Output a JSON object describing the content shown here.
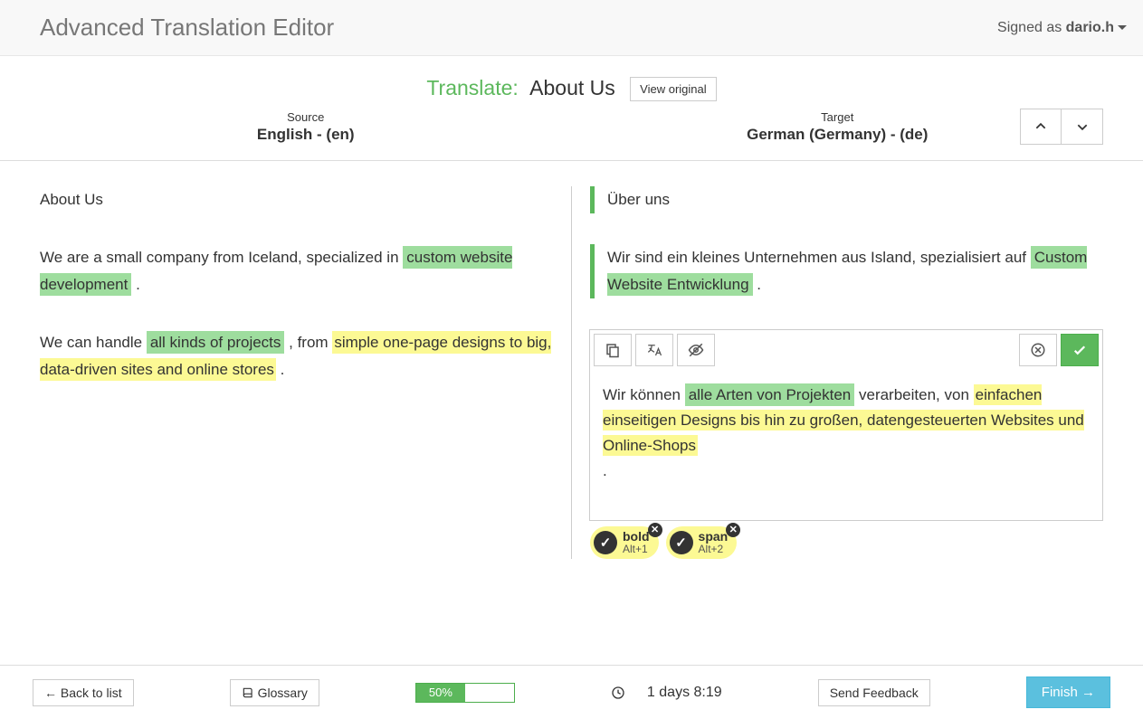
{
  "header": {
    "title": "Advanced Translation Editor",
    "signed_as_label": "Signed as ",
    "username": "dario.h"
  },
  "translate_header": {
    "label": "Translate:",
    "doc_title": "About Us",
    "view_original_label": "View original"
  },
  "langs": {
    "source_label": "Source",
    "source_name": "English - (en)",
    "target_label": "Target",
    "target_name": "German (Germany) - (de)"
  },
  "segments": {
    "src1": "About Us",
    "tgt1": "Über uns",
    "src2_pre": "We are a small company from Iceland, specialized in ",
    "src2_hl": "custom website development",
    "src2_post": " .",
    "tgt2_pre": "Wir sind ein kleines Unternehmen aus Island, spezialisiert auf ",
    "tgt2_hl": "Custom Website Entwicklung",
    "tgt2_post": " .",
    "src3_pre": "We can handle ",
    "src3_hl_green": "all kinds of projects",
    "src3_mid": " , from ",
    "src3_hl_yellow": "simple one-page designs to big, data-driven sites and online stores",
    "src3_post": " .",
    "tgt3_pre": "Wir können ",
    "tgt3_hl_green": "alle Arten von Projekten",
    "tgt3_mid": " verarbeiten, von ",
    "tgt3_hl_yellow": "einfachen einseitigen Designs bis hin zu großen, datengesteuerten Websites und Online-Shops",
    "tgt3_post": "."
  },
  "tags": {
    "t1_name": "bold",
    "t1_shortcut": "Alt+1",
    "t2_name": "span",
    "t2_shortcut": "Alt+2"
  },
  "footer": {
    "back_label": "← Back to list",
    "glossary_label": "Glossary",
    "progress_text": "50%",
    "time_text": "1 days 8:19",
    "feedback_label": "Send Feedback",
    "finish_label": "Finish →"
  }
}
